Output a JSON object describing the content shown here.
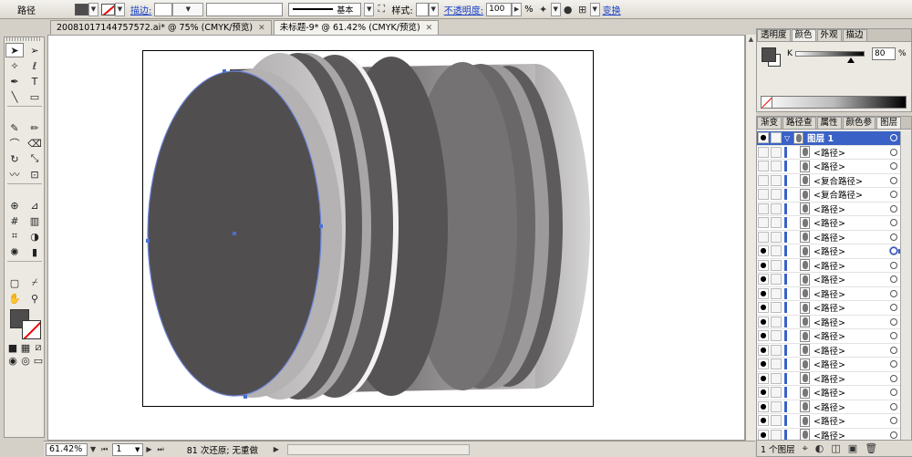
{
  "control_bar": {
    "selection_label": "路径",
    "stroke_link": "描边:",
    "stroke_profile": "基本",
    "style_label": "样式:",
    "opacity_link": "不透明度:",
    "opacity_value": "100",
    "opacity_unit": "%",
    "transform_link": "变换",
    "fill_color": "#4f4c4d"
  },
  "document_tabs": [
    {
      "label": "20081017144757572.ai* @ 75% (CMYK/预览)",
      "active": false
    },
    {
      "label": "未标题-9* @ 61.42% (CMYK/预览)",
      "active": true
    }
  ],
  "status_bar": {
    "zoom": "61.42%",
    "artboard_number": "1",
    "status_text": "81 次还原; 无重做"
  },
  "color_panel": {
    "tabs": [
      "透明度",
      "颜色",
      "外观",
      "描边"
    ],
    "active_tab": "颜色",
    "channel_label": "K",
    "channel_value": "80",
    "channel_unit": "%",
    "k_level_percent": 80
  },
  "layers_panel": {
    "tabs": [
      "渐变",
      "路径查",
      "属性",
      "颜色参",
      "图层"
    ],
    "active_tab": "图层",
    "layer_name": "图层 1",
    "items": [
      {
        "label": "<路径>",
        "eye": false
      },
      {
        "label": "<路径>",
        "eye": false
      },
      {
        "label": "<复合路径>",
        "eye": false
      },
      {
        "label": "<复合路径>",
        "eye": false
      },
      {
        "label": "<路径>",
        "eye": false
      },
      {
        "label": "<路径>",
        "eye": false
      },
      {
        "label": "<路径>",
        "eye": false
      },
      {
        "label": "<路径>",
        "eye": true,
        "selected": true
      },
      {
        "label": "<路径>",
        "eye": true
      },
      {
        "label": "<路径>",
        "eye": true
      },
      {
        "label": "<路径>",
        "eye": true
      },
      {
        "label": "<路径>",
        "eye": true
      },
      {
        "label": "<路径>",
        "eye": true
      },
      {
        "label": "<路径>",
        "eye": true
      },
      {
        "label": "<路径>",
        "eye": true
      },
      {
        "label": "<路径>",
        "eye": true
      },
      {
        "label": "<路径>",
        "eye": true
      },
      {
        "label": "<路径>",
        "eye": true
      },
      {
        "label": "<路径>",
        "eye": true
      },
      {
        "label": "<路径>",
        "eye": true
      },
      {
        "label": "<路径>",
        "eye": true
      }
    ],
    "footer_text": "1 个图层"
  },
  "toolbox": {
    "tools": [
      "selection-tool",
      "direct-selection-tool",
      "magic-wand-tool",
      "lasso-tool",
      "pen-tool",
      "type-tool",
      "line-tool",
      "rectangle-tool",
      "paintbrush-tool",
      "pencil-tool",
      "blob-brush-tool",
      "eraser-tool",
      "rotate-tool",
      "scale-tool",
      "warp-tool",
      "free-transform-tool",
      "shape-builder-tool",
      "perspective-grid-tool",
      "mesh-tool",
      "gradient-tool",
      "eyedropper-tool",
      "blend-tool",
      "symbol-sprayer-tool",
      "column-graph-tool",
      "artboard-tool",
      "slice-tool",
      "hand-tool",
      "zoom-tool"
    ]
  }
}
